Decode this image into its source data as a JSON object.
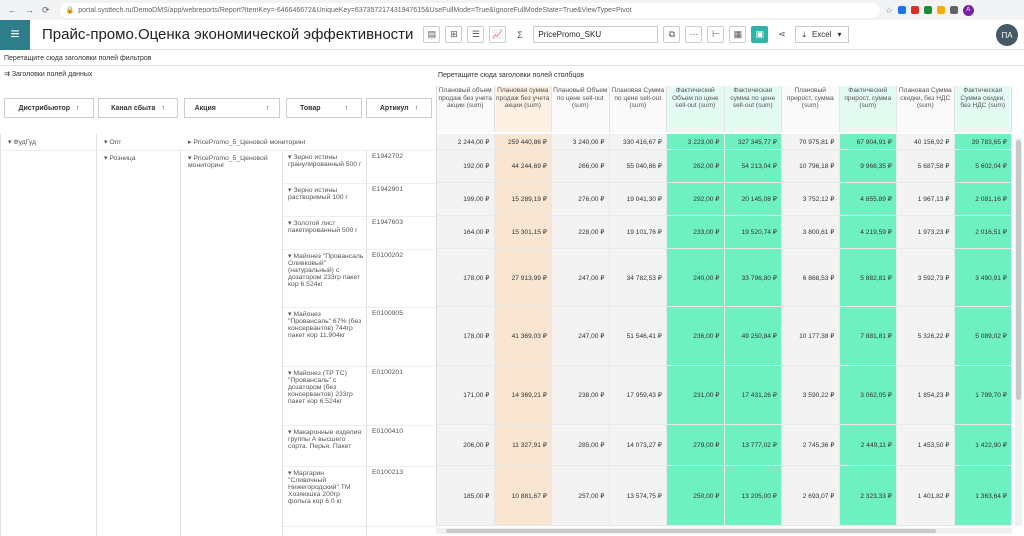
{
  "browser": {
    "url": "portal.systtech.ru/DemoDMS/app/webreports/Report?ItemKey=-646646672&UniqueKey=637357217431947615&UseFullMode=True&IgnoreFullModeState=True&ViewType=Pivot",
    "profile": "A"
  },
  "app": {
    "title": "Прайс-промо.Оценка экономической эффективности",
    "select_value": "PricePromo_SKU",
    "excel_label": "Excel",
    "user_initials": "ПА"
  },
  "hints": {
    "filters": "Перетащите сюда заголовки полей фильтров",
    "data_fields": "Заголовки полей данных",
    "columns": "Перетащите сюда заголовки полей столбцов"
  },
  "row_headers": [
    "Дистрибьютор",
    "Канал сбыта",
    "Акция",
    "Товар",
    "Артикул"
  ],
  "columns": [
    {
      "label": "Плановый объем продаж без учета акции (sum)",
      "color": "#f3f3f3"
    },
    {
      "label": "Плановая сумма продаж без учета акции (sum)",
      "color": "#f8e6d2"
    },
    {
      "label": "Плановый Объем по цене sell-out (sum)",
      "color": "#f3f3f3"
    },
    {
      "label": "Плановая Сумма по цене sell-out (sum)",
      "color": "#f3f3f3"
    },
    {
      "label": "Фактический Объем по цене sell-out (sum)",
      "color": "#6ff0c0"
    },
    {
      "label": "Фактическая сумма по цене sell-out (sum)",
      "color": "#6ff0c0"
    },
    {
      "label": "Плановый прирост, сумма (sum)",
      "color": "#f3f3f3"
    },
    {
      "label": "Фактический прирост, сумма (sum)",
      "color": "#6ff0c0"
    },
    {
      "label": "Плановая Сумма скидки, без НДС (sum)",
      "color": "#f3f3f3"
    },
    {
      "label": "Фактическая Сумма скидки, без НДС (sum)",
      "color": "#6ff0c0"
    }
  ],
  "tree": {
    "distributor": "ФудГуд",
    "channel_opt": "Опт",
    "channel_retail": "Розница",
    "promo_opt": "PricePromo_5_Ценовой мониторинг",
    "promo_retail": "PricePromo_5_Ценовой мониторинг"
  },
  "rows": [
    {
      "product": "",
      "sku": "",
      "values": [
        "2 244,00 ₽",
        "259 440,86 ₽",
        "3 240,00 ₽",
        "330 416,67 ₽",
        "3 223,00 ₽",
        "327 345,77 ₽",
        "70 975,81 ₽",
        "67 904,91 ₽",
        "40 156,92 ₽",
        "39 783,65 ₽"
      ]
    },
    {
      "product": "Зерно истины гранулированный 500 г",
      "sku": "E1942702",
      "values": [
        "192,00 ₽",
        "44 244,69 ₽",
        "266,00 ₽",
        "55 040,86 ₽",
        "262,00 ₽",
        "54 213,04 ₽",
        "10 796,18 ₽",
        "9 968,35 ₽",
        "5 687,58 ₽",
        "5 602,04 ₽"
      ]
    },
    {
      "product": "Зерно истины растворимый 100 г",
      "sku": "E1942901",
      "values": [
        "199,00 ₽",
        "15 289,19 ₽",
        "276,00 ₽",
        "19 041,30 ₽",
        "292,00 ₽",
        "20 145,08 ₽",
        "3 752,12 ₽",
        "4 855,89 ₽",
        "1 967,13 ₽",
        "2 081,16 ₽"
      ]
    },
    {
      "product": "Золотой лист пакетированный 500 г",
      "sku": "E1947603",
      "values": [
        "164,00 ₽",
        "15 301,15 ₽",
        "228,00 ₽",
        "19 101,76 ₽",
        "233,00 ₽",
        "19 520,74 ₽",
        "3 800,61 ₽",
        "4 219,59 ₽",
        "1 973,23 ₽",
        "2 016,51 ₽"
      ]
    },
    {
      "product": "Майонез \"Провансаль Оливковый\" (натуральный) с дозатором 233гр пакет кор 6.524кг",
      "sku": "E0100202",
      "values": [
        "178,00 ₽",
        "27 913,99 ₽",
        "247,00 ₽",
        "34 782,53 ₽",
        "240,00 ₽",
        "33 796,80 ₽",
        "6 868,53 ₽",
        "5 882,81 ₽",
        "3 592,73 ₽",
        "3 490,91 ₽"
      ]
    },
    {
      "product": "Майонез \"Провансаль\" 67% (без консервантов) 744гр пакет кор 11.904кг",
      "sku": "E0100905",
      "values": [
        "178,00 ₽",
        "41 369,03 ₽",
        "247,00 ₽",
        "51 546,41 ₽",
        "236,00 ₽",
        "49 250,84 ₽",
        "10 177,38 ₽",
        "7 881,81 ₽",
        "5 326,22 ₽",
        "5 089,02 ₽"
      ]
    },
    {
      "product": "Майонез (ТР ТС) \"Провансаль\" с дозатором (без консервантов) 233гр пакет кор 6.524кг",
      "sku": "E0100201",
      "values": [
        "171,00 ₽",
        "14 369,21 ₽",
        "238,00 ₽",
        "17 959,43 ₽",
        "231,00 ₽",
        "17 431,26 ₽",
        "3 590,22 ₽",
        "3 062,05 ₽",
        "1 854,23 ₽",
        "1 799,70 ₽"
      ]
    },
    {
      "product": "Макаронные изделия группы А высшего сорта. Перья. Пакет",
      "sku": "E0100410",
      "values": [
        "206,00 ₽",
        "11 327,91 ₽",
        "285,00 ₽",
        "14 073,27 ₽",
        "279,00 ₽",
        "13 777,02 ₽",
        "2 745,36 ₽",
        "2 449,11 ₽",
        "1 453,50 ₽",
        "1 422,90 ₽"
      ]
    },
    {
      "product": "Маргарин \"Сливочный Нижегородский\" ТМ Хозяюшка 200гр фольга кор 6.0 кг",
      "sku": "E0100213",
      "values": [
        "185,00 ₽",
        "10 881,67 ₽",
        "257,00 ₽",
        "13 574,75 ₽",
        "250,00 ₽",
        "13 205,00 ₽",
        "2 693,07 ₽",
        "2 323,33 ₽",
        "1 401,82 ₽",
        "1 363,64 ₽"
      ]
    }
  ]
}
